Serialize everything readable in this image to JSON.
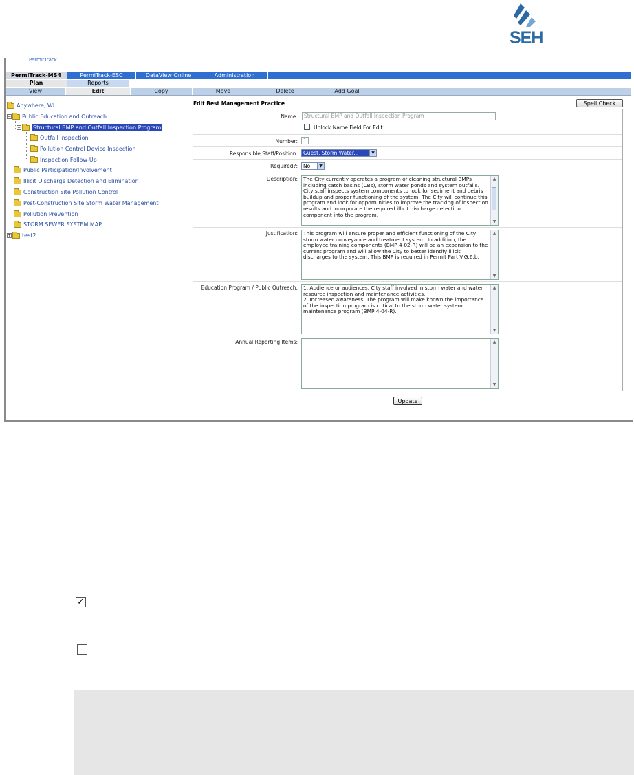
{
  "logo": {
    "text": "SEH"
  },
  "app": {
    "brand_partial": "PermitTrack",
    "top_tabs": [
      {
        "label": "PermiTrack-MS4",
        "active": true
      },
      {
        "label": "PermiTrack-ESC",
        "active": false
      },
      {
        "label": "DataView Online",
        "active": false
      },
      {
        "label": "Administration",
        "active": false
      }
    ],
    "sub_tabs": [
      {
        "label": "Plan",
        "active": true
      },
      {
        "label": "Reports",
        "active": false
      }
    ],
    "actions": [
      {
        "label": "View",
        "active": false
      },
      {
        "label": "Edit",
        "active": true
      },
      {
        "label": "Copy",
        "active": false
      },
      {
        "label": "Move",
        "active": false
      },
      {
        "label": "Delete",
        "active": false
      },
      {
        "label": "Add Goal",
        "active": false
      }
    ]
  },
  "tree": {
    "root": "Anywhere, WI",
    "items": [
      "Public Education and Outreach",
      "Structural BMP and Outfall Inspection Program",
      "Outfall Inspection",
      "Pollution Control Device Inspection",
      "Inspection Follow-Up",
      "Public Participation/Involvement",
      "Illicit Discharge Detection and Elimination",
      "Construction Site Pollution Control",
      "Post-Construction Site Storm Water Management",
      "Pollution Prevention",
      "STORM SEWER SYSTEM MAP",
      "test2"
    ]
  },
  "form": {
    "title": "Edit Best Management Practice",
    "spell_check": "Spell Check",
    "name_label": "Name:",
    "name_value": "Structural BMP and Outfall Inspection Program",
    "unlock_label": "Unlock Name Field For Edit",
    "number_label": "Number:",
    "number_value": "1",
    "staff_label": "Responsible Staff/Position:",
    "staff_value": "Guest, Storm Water...",
    "required_label": "Required?:",
    "required_value": "No",
    "description_label": "Description:",
    "description_value": "The City currently operates a program of cleaning structural BMPs including catch basins (CBs), storm water ponds and system outfalls. City staff inspects system components to look for sediment and debris buildup and proper functioning of the system. The City will continue this program and look for opportunities to improve the tracking of inspection results and incorporate the required illicit discharge detection component into the program.",
    "justification_label": "Justification:",
    "justification_value": "This program will ensure proper and efficient functioning of the City storm water conveyance and treatment system. In addition, the employee training components (BMP 4-02-R) will be an expansion to the current program and will allow the City to better identify illicit discharges to the system. This BMP is required in Permit Part V.G.6.b.",
    "education_label": "Education Program / Public Outreach:",
    "education_line1": "1.            Audience or audiences: City staff involved in storm water and water resource inspection and maintenance activities.",
    "education_line2": "2.            Increased awareness: The program will make known the importance of the inspection program is critical to the storm water system maintenance program (BMP 4-04-R).",
    "annual_label": "Annual Reporting Items:",
    "annual_value": "",
    "update": "Update"
  },
  "legend": {
    "checked": true,
    "unchecked": false
  }
}
